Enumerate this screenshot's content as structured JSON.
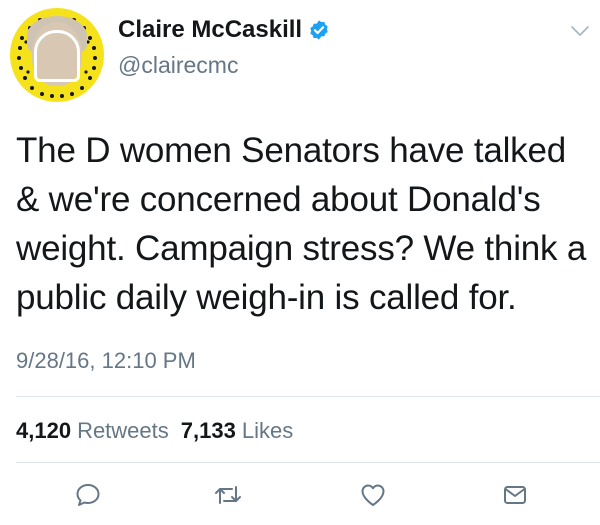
{
  "tweet": {
    "author_name": "Claire McCaskill",
    "handle": "@clairecmc",
    "verified": true,
    "text": "The D women Senators have talked & we're concerned about Donald's weight. Campaign stress? We think a public daily weigh-in is called for.",
    "timestamp": "9/28/16, 12:10 PM",
    "retweets_count": "4,120",
    "retweets_label": "Retweets",
    "likes_count": "7,133",
    "likes_label": "Likes"
  },
  "colors": {
    "accent": "#1da1f2",
    "muted": "#657786",
    "avatar_bg": "#f5e21b"
  },
  "icons": {
    "avatar": "snapcode-avatar",
    "verified": "verified-badge-icon",
    "menu": "chevron-down-icon",
    "reply": "reply-icon",
    "retweet": "retweet-icon",
    "like": "heart-icon",
    "message": "envelope-icon"
  }
}
